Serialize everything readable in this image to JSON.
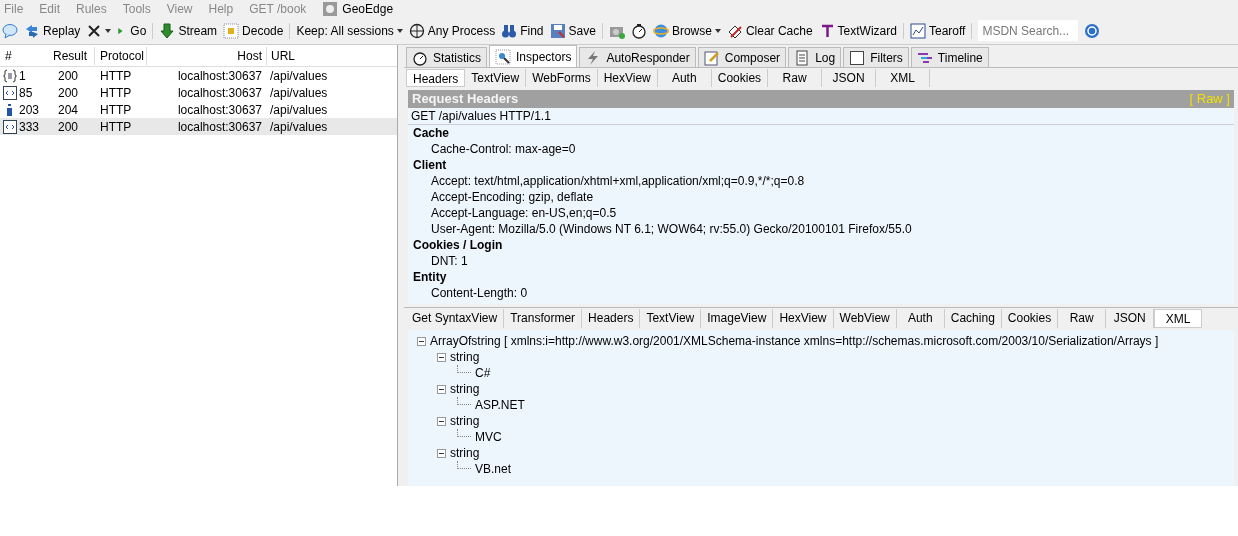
{
  "menu": [
    "File",
    "Edit",
    "Rules",
    "Tools",
    "View",
    "Help",
    "GET /book"
  ],
  "geoedge": "GeoEdge",
  "toolbar": [
    {
      "kind": "icon"
    },
    {
      "kind": "button",
      "label": "Replay"
    },
    {
      "kind": "menu"
    },
    {
      "kind": "button",
      "label": "Go"
    },
    {
      "kind": "button",
      "label": "Stream"
    },
    {
      "kind": "button",
      "label": "Decode"
    },
    {
      "kind": "menu",
      "label": "Keep: All sessions"
    },
    {
      "kind": "button",
      "label": "Any Process"
    },
    {
      "kind": "button",
      "label": "Find"
    },
    {
      "kind": "button",
      "label": "Save"
    },
    {
      "kind": "icon"
    },
    {
      "kind": "icon"
    },
    {
      "kind": "menu",
      "label": "Browse"
    },
    {
      "kind": "button",
      "label": "Clear Cache"
    },
    {
      "kind": "button",
      "label": "TextWizard"
    },
    {
      "kind": "button",
      "label": "Tearoff"
    }
  ],
  "search": {
    "placeholder": "MSDN Search..."
  },
  "sessions": {
    "columns": [
      "#",
      "Result",
      "Protocol",
      "Host",
      "URL"
    ],
    "rows": [
      {
        "kind": "json",
        "id": "1",
        "result": "200",
        "protocol": "HTTP",
        "host": "localhost:30637",
        "url": "/api/values",
        "selected": false
      },
      {
        "kind": "xml",
        "id": "85",
        "result": "200",
        "protocol": "HTTP",
        "host": "localhost:30637",
        "url": "/api/values",
        "selected": false
      },
      {
        "kind": "info",
        "id": "203",
        "result": "204",
        "protocol": "HTTP",
        "host": "localhost:30637",
        "url": "/api/values",
        "selected": false
      },
      {
        "kind": "xml",
        "id": "333",
        "result": "200",
        "protocol": "HTTP",
        "host": "localhost:30637",
        "url": "/api/values",
        "selected": true
      }
    ]
  },
  "main_tabs": [
    {
      "label": "Statistics",
      "selected": false
    },
    {
      "label": "Inspectors",
      "selected": true
    },
    {
      "label": "AutoResponder",
      "selected": false
    },
    {
      "label": "Composer",
      "selected": false
    },
    {
      "label": "Log",
      "selected": false
    },
    {
      "label": "Filters",
      "selected": false
    },
    {
      "label": "Timeline",
      "selected": false
    }
  ],
  "request_tabs": [
    {
      "label": "Headers",
      "selected": true
    },
    {
      "label": "TextView",
      "selected": false
    },
    {
      "label": "WebForms",
      "selected": false
    },
    {
      "label": "HexView",
      "selected": false
    },
    {
      "label": "Auth",
      "selected": false
    },
    {
      "label": "Cookies",
      "selected": false
    },
    {
      "label": "Raw",
      "selected": false
    },
    {
      "label": "JSON",
      "selected": false
    },
    {
      "label": "XML",
      "selected": false
    }
  ],
  "request_headers": {
    "title": "Request Headers",
    "raw_link": "[ Raw ]",
    "request_line": "GET /api/values HTTP/1.1",
    "groups": [
      {
        "name": "Cache",
        "lines": [
          "Cache-Control: max-age=0"
        ]
      },
      {
        "name": "Client",
        "lines": [
          "Accept: text/html,application/xhtml+xml,application/xml;q=0.9,*/*;q=0.8",
          "Accept-Encoding: gzip, deflate",
          "Accept-Language: en-US,en;q=0.5",
          "User-Agent: Mozilla/5.0 (Windows NT 6.1; WOW64; rv:55.0) Gecko/20100101 Firefox/55.0"
        ]
      },
      {
        "name": "Cookies / Login",
        "lines": [
          "DNT: 1"
        ]
      },
      {
        "name": "Entity",
        "lines": [
          "Content-Length: 0"
        ]
      }
    ]
  },
  "response_tabs": [
    {
      "label": "Get SyntaxView",
      "selected": false
    },
    {
      "label": "Transformer",
      "selected": false
    },
    {
      "label": "Headers",
      "selected": false
    },
    {
      "label": "TextView",
      "selected": false
    },
    {
      "label": "ImageView",
      "selected": false
    },
    {
      "label": "HexView",
      "selected": false
    },
    {
      "label": "WebView",
      "selected": false
    },
    {
      "label": "Auth",
      "selected": false
    },
    {
      "label": "Caching",
      "selected": false
    },
    {
      "label": "Cookies",
      "selected": false
    },
    {
      "label": "Raw",
      "selected": false
    },
    {
      "label": "JSON",
      "selected": false
    },
    {
      "label": "XML",
      "selected": true
    }
  ],
  "xml_tree": [
    {
      "label": "ArrayOfstring [ xmlns:i=http://www.w3.org/2001/XMLSchema-instance xmlns=http://schemas.microsoft.com/2003/10/Serialization/Arrays ]",
      "expanded": true,
      "children": [
        {
          "label": "string",
          "expanded": true,
          "children": [
            {
              "label": "C#"
            }
          ]
        },
        {
          "label": "string",
          "expanded": true,
          "children": [
            {
              "label": "ASP.NET"
            }
          ]
        },
        {
          "label": "string",
          "expanded": true,
          "children": [
            {
              "label": "MVC"
            }
          ]
        },
        {
          "label": "string",
          "expanded": true,
          "children": [
            {
              "label": "VB.net"
            }
          ]
        }
      ]
    }
  ]
}
